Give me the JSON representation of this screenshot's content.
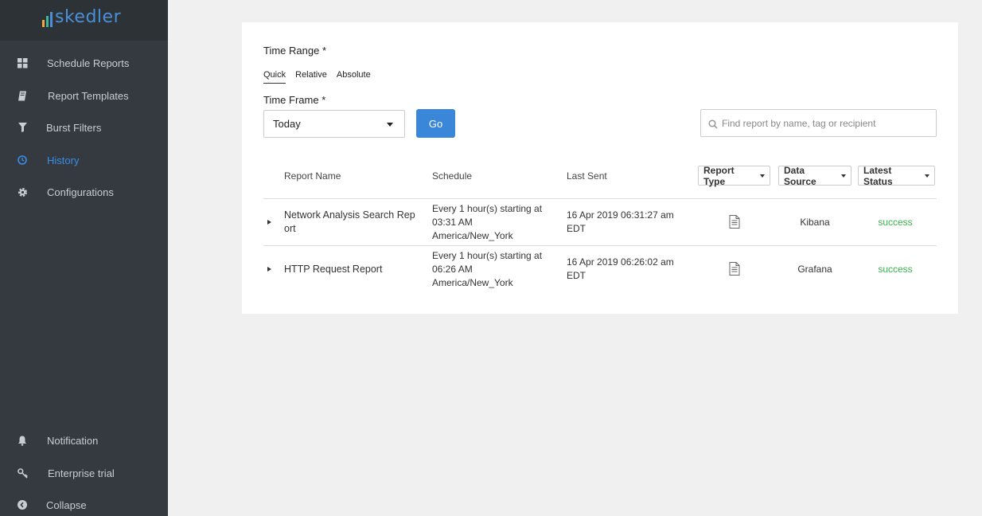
{
  "app": {
    "logo_text": "skedler"
  },
  "sidebar": {
    "items": [
      {
        "label": "Schedule Reports",
        "icon": "grid-icon"
      },
      {
        "label": "Report Templates",
        "icon": "book-icon"
      },
      {
        "label": "Burst Filters",
        "icon": "filter-icon"
      },
      {
        "label": "History",
        "icon": "clock-icon",
        "active": true
      },
      {
        "label": "Configurations",
        "icon": "gear-icon"
      }
    ],
    "bottom_items": [
      {
        "label": "Notification",
        "icon": "bell-icon"
      },
      {
        "label": "Enterprise trial",
        "icon": "key-icon"
      },
      {
        "label": "Collapse",
        "icon": "chevron-left-circle-icon"
      }
    ]
  },
  "filters": {
    "time_range_label": "Time Range *",
    "tabs": [
      "Quick",
      "Relative",
      "Absolute"
    ],
    "active_tab": "Quick",
    "time_frame_label": "Time Frame *",
    "time_frame_value": "Today",
    "go_label": "Go",
    "search_placeholder": "Find report by name, tag or recipient"
  },
  "table": {
    "headers": {
      "report_name": "Report Name",
      "schedule": "Schedule",
      "last_sent": "Last Sent",
      "report_type": "Report Type",
      "data_source": "Data Source",
      "latest_status": "Latest Status"
    },
    "rows": [
      {
        "name_line1": "Network Analysis Search Rep",
        "name_line2": "ort",
        "schedule_line1": "Every 1 hour(s) starting at",
        "schedule_line2": "03:31 AM",
        "schedule_line3": "America/New_York",
        "last_sent_line1": "16 Apr 2019 06:31:27 am",
        "last_sent_line2": "EDT",
        "report_type_icon": "document-icon",
        "data_source": "Kibana",
        "status": "success"
      },
      {
        "name_line1": "HTTP Request Report",
        "schedule_line1": "Every 1 hour(s) starting at",
        "schedule_line2": "06:26 AM",
        "schedule_line3": "America/New_York",
        "last_sent_line1": "16 Apr 2019 06:26:02 am",
        "last_sent_line2": "EDT",
        "report_type_icon": "document-icon",
        "data_source": "Grafana",
        "status": "success"
      }
    ]
  },
  "colors": {
    "sidebar_bg": "#343a40",
    "accent": "#3a86d9",
    "success": "#37b24d"
  }
}
